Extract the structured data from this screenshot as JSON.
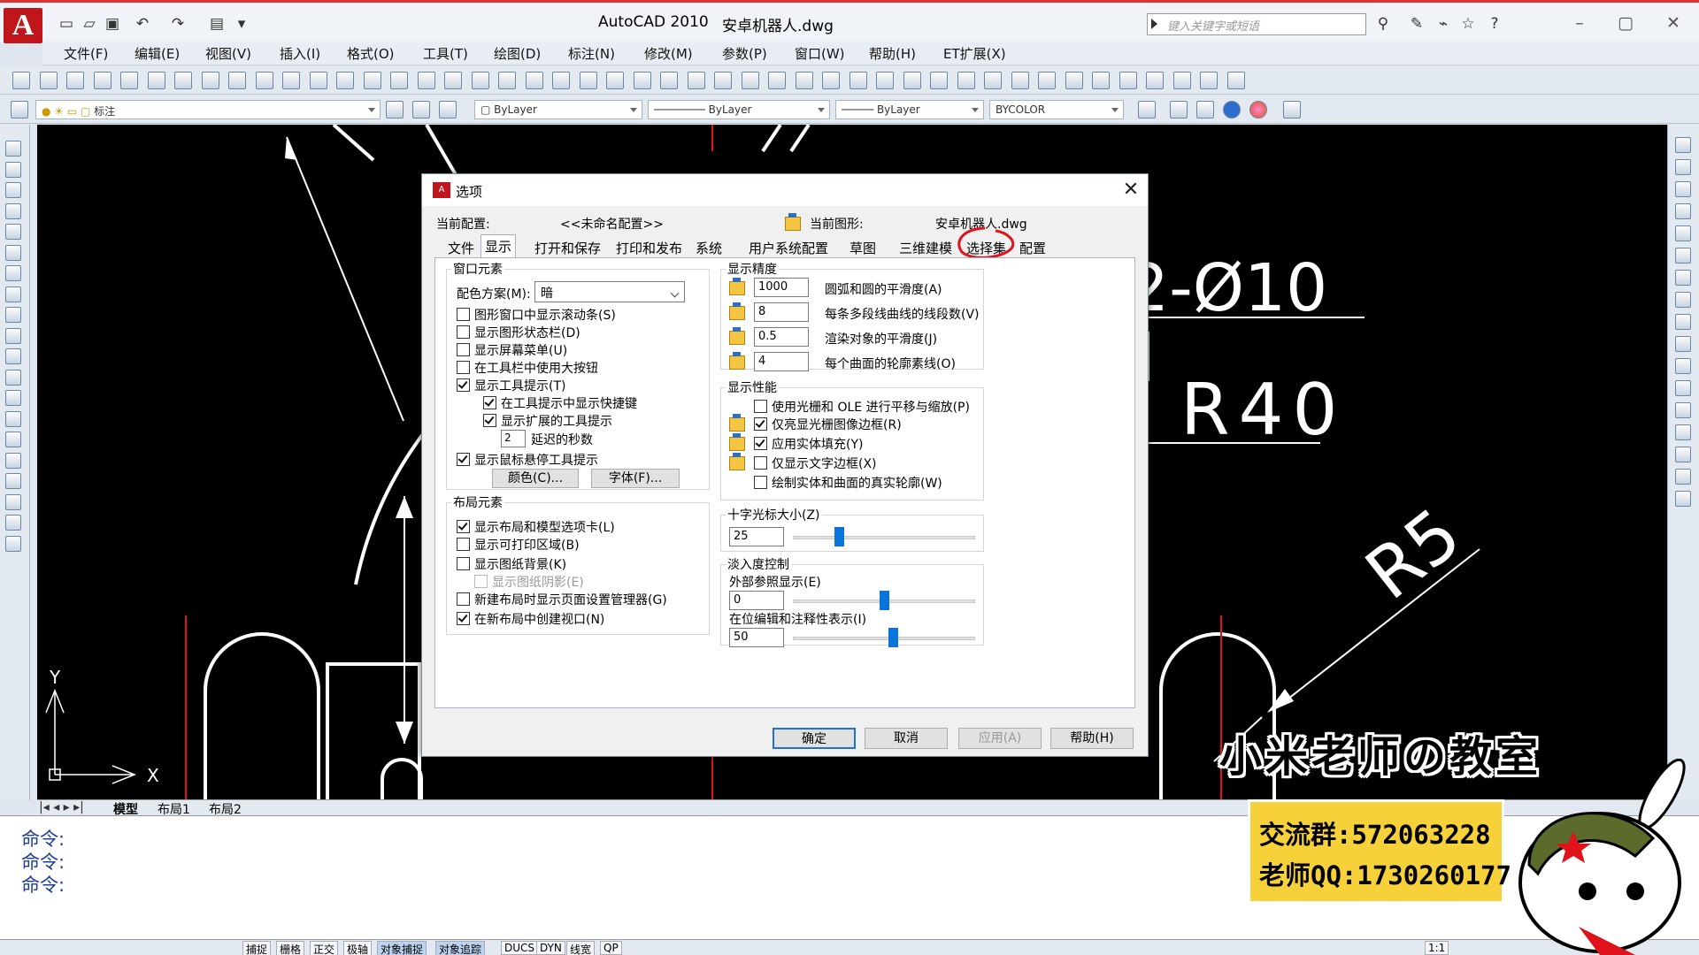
{
  "app": {
    "logo_letter": "A",
    "title": "AutoCAD 2010",
    "filename": "安卓机器人.dwg",
    "search_placeholder": "键入关键字或短语"
  },
  "menu": [
    "文件(F)",
    "编辑(E)",
    "视图(V)",
    "插入(I)",
    "格式(O)",
    "工具(T)",
    "绘图(D)",
    "标注(N)",
    "修改(M)",
    "参数(P)",
    "窗口(W)",
    "帮助(H)",
    "ET扩展(X)"
  ],
  "properties_bar": {
    "layer": "标注",
    "color": "ByLayer",
    "linetype": "ByLayer",
    "lineweight": "ByLayer",
    "plotstyle": "BYCOLOR"
  },
  "drawing": {
    "dim_hole": "2-Ø10",
    "dim_r40": "R40",
    "dim_r5": "R5",
    "axis_y": "Y",
    "axis_x": "X"
  },
  "layout_tabs": [
    "模型",
    "布局1",
    "布局2"
  ],
  "command_lines": [
    "命令:",
    "命令:",
    "命令:"
  ],
  "status_buttons": [
    "捕捉",
    "栅格",
    "正交",
    "极轴",
    "对象捕捉",
    "对象追踪",
    "DUCS",
    "DYN",
    "线宽",
    "QP"
  ],
  "status_scale": "1:1",
  "dialog": {
    "title": "选项",
    "current_profile_label": "当前配置:",
    "current_profile_value": "<<未命名配置>>",
    "current_drawing_label": "当前图形:",
    "current_drawing_value": "安卓机器人.dwg",
    "tabs": [
      "文件",
      "显示",
      "打开和保存",
      "打印和发布",
      "系统",
      "用户系统配置",
      "草图",
      "三维建模",
      "选择集",
      "配置"
    ],
    "active_tab": "显示",
    "window_elements": {
      "title": "窗口元素",
      "color_scheme_label": "配色方案(M):",
      "color_scheme_value": "暗",
      "checkboxes": [
        {
          "label": "图形窗口中显示滚动条(S)",
          "checked": false
        },
        {
          "label": "显示图形状态栏(D)",
          "checked": false
        },
        {
          "label": "显示屏幕菜单(U)",
          "checked": false
        },
        {
          "label": "在工具栏中使用大按钮",
          "checked": false
        },
        {
          "label": "显示工具提示(T)",
          "checked": true
        },
        {
          "label": "在工具提示中显示快捷键",
          "checked": true
        },
        {
          "label": "显示扩展的工具提示",
          "checked": true
        },
        {
          "label": "显示鼠标悬停工具提示",
          "checked": true
        }
      ],
      "delay_value": "2",
      "delay_label": "延迟的秒数",
      "colors_button": "颜色(C)...",
      "fonts_button": "字体(F)..."
    },
    "layout_elements": {
      "title": "布局元素",
      "checkboxes": [
        {
          "label": "显示布局和模型选项卡(L)",
          "checked": true
        },
        {
          "label": "显示可打印区域(B)",
          "checked": false
        },
        {
          "label": "显示图纸背景(K)",
          "checked": false
        },
        {
          "label": "显示图纸阴影(E)",
          "checked": false
        },
        {
          "label": "新建布局时显示页面设置管理器(G)",
          "checked": false
        },
        {
          "label": "在新布局中创建视口(N)",
          "checked": true
        }
      ]
    },
    "display_resolution": {
      "title": "显示精度",
      "rows": [
        {
          "value": "1000",
          "label": "圆弧和圆的平滑度(A)"
        },
        {
          "value": "8",
          "label": "每条多段线曲线的线段数(V)"
        },
        {
          "value": "0.5",
          "label": "渲染对象的平滑度(J)"
        },
        {
          "value": "4",
          "label": "每个曲面的轮廓素线(O)"
        }
      ]
    },
    "display_performance": {
      "title": "显示性能",
      "checkboxes": [
        {
          "label": "使用光栅和 OLE 进行平移与缩放(P)",
          "checked": false
        },
        {
          "label": "仅亮显光栅图像边框(R)",
          "checked": true
        },
        {
          "label": "应用实体填充(Y)",
          "checked": true
        },
        {
          "label": "仅显示文字边框(X)",
          "checked": false
        },
        {
          "label": "绘制实体和曲面的真实轮廓(W)",
          "checked": false
        }
      ]
    },
    "crosshair": {
      "title": "十字光标大小(Z)",
      "value": "25",
      "fraction": 0.25
    },
    "fade_control": {
      "title": "淡入度控制",
      "xref_label": "外部参照显示(E)",
      "xref_value": "0",
      "xref_fraction": 0.5,
      "inplace_label": "在位编辑和注释性表示(I)",
      "inplace_value": "50",
      "inplace_fraction": 0.55
    },
    "buttons": {
      "ok": "确定",
      "cancel": "取消",
      "apply": "应用(A)",
      "help": "帮助(H)"
    }
  },
  "promo": {
    "title": "小米老师の教室",
    "line1": "交流群:572063228",
    "line2": "老师QQ:1730260177"
  },
  "colors": {
    "accent": "#1e73d2",
    "canvas": "#000000",
    "annotation": "#e0131b",
    "promo_box": "#f7d13a"
  }
}
